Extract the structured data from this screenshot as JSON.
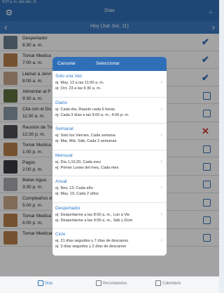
{
  "statusbar": {
    "text": "9:27 a. m.  Jun Jun. 11"
  },
  "navbar": {
    "title": "Días",
    "plus": "+",
    "gear": "⚙"
  },
  "datebar": {
    "label": "Hoy (Jue Jun. 11)",
    "prev": "‹",
    "next": "›"
  },
  "items": [
    {
      "name": "Despertador",
      "time": "6:30 a. m.",
      "status": "check"
    },
    {
      "name": "Tomar Medica",
      "time": "7:00 a. m.",
      "status": "check"
    },
    {
      "name": "Llamar a Jenn",
      "time": "8:00 a. m.",
      "status": "check"
    },
    {
      "name": "Alimentar al P",
      "time": "9:30 a. m.",
      "status": "box"
    },
    {
      "name": "Cita con el Do",
      "time": "11:30 a. m.",
      "status": "box"
    },
    {
      "name": "Reunión de Tra",
      "time": "12:30 p. m.",
      "status": "cross"
    },
    {
      "name": "Tomar Medica",
      "time": "1:00 p. m.",
      "status": "box"
    },
    {
      "name": "Pagos",
      "time": "2:00 p. m.",
      "status": "box"
    },
    {
      "name": "Beber Agua",
      "time": "3:30 p. m.",
      "status": "box"
    },
    {
      "name": "Cumpleaños d",
      "time": "5:00 p. m.",
      "status": "box"
    },
    {
      "name": "Tomar Medica",
      "time": "6:00 p. m.",
      "status": "box"
    },
    {
      "name": "Tomar Medicamento",
      "time": "",
      "status": "box"
    }
  ],
  "modal": {
    "cancel": "Cancelar",
    "title": "Seleccionar",
    "options": [
      {
        "title": "Solo una Vez",
        "examples": [
          "ej: May. 13 a las 11:00 a. m.",
          "ej: Oct. 23 a las 9:30 a. m."
        ]
      },
      {
        "title": "Diario",
        "examples": [
          "ej: Cada día, Repetir cada 6 horas",
          "ej: Cada 3 días a las 9:00 a. m., 4:00 p. m."
        ]
      },
      {
        "title": "Semanal",
        "examples": [
          "ej: Solo los Viernes, Cada semana",
          "ej: Mar, Mié, Sáb, Cada 2 semanas"
        ]
      },
      {
        "title": "Mensual",
        "examples": [
          "ej: Día 1,10,20, Cada mes",
          "ej: Primer Lunes del mes, Cada mes"
        ]
      },
      {
        "title": "Anual",
        "examples": [
          "ej: Nov. 13, Cada año",
          "ej: May. 19, Cada 2 años"
        ]
      },
      {
        "title": "Despertador",
        "examples": [
          "ej: Despertarme a las 8:00 a. m., Lun a Vie",
          "ej: Despertarme a las 9:00 a. m., Sáb y Dom"
        ]
      },
      {
        "title": "Ciclo",
        "examples": [
          "ej: 21 días seguidos y 7 días de descanso",
          "ej: 3 días seguidos y 2 días de descanso"
        ]
      }
    ]
  },
  "tabs": [
    {
      "label": "Días",
      "icon": "calendar-grid-icon",
      "active": true
    },
    {
      "label": "Recordatorios",
      "icon": "list-icon",
      "active": false
    },
    {
      "label": "Calendario",
      "icon": "calendar-icon",
      "active": false
    }
  ],
  "colors": {
    "primary": "#2f6fb8",
    "error": "#d2322d",
    "overlay": "rgba(0,0,0,0.36)"
  }
}
